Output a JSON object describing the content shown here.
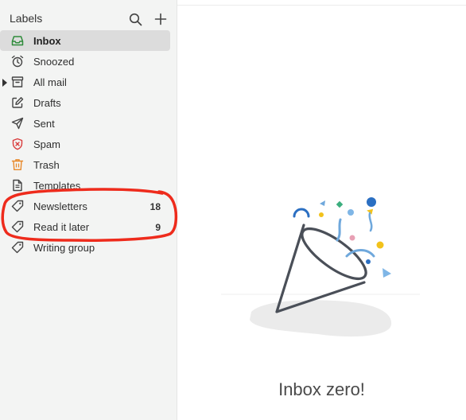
{
  "sidebar": {
    "title": "Labels",
    "items": [
      {
        "label": "Inbox",
        "icon": "inbox-icon",
        "active": true
      },
      {
        "label": "Snoozed",
        "icon": "snooze-clock-icon"
      },
      {
        "label": "All mail",
        "icon": "archive-box-icon"
      },
      {
        "label": "Drafts",
        "icon": "draft-edit-icon"
      },
      {
        "label": "Sent",
        "icon": "paper-plane-icon"
      },
      {
        "label": "Spam",
        "icon": "spam-shield-icon"
      },
      {
        "label": "Trash",
        "icon": "trash-can-icon"
      },
      {
        "label": "Templates",
        "icon": "template-doc-icon"
      },
      {
        "label": "Newsletters",
        "icon": "tag-icon",
        "count": "18"
      },
      {
        "label": "Read it later",
        "icon": "tag-icon",
        "count": "9"
      },
      {
        "label": "Writing group",
        "icon": "tag-icon"
      }
    ]
  },
  "main": {
    "empty_message": "Inbox zero!"
  },
  "colors": {
    "active_bg": "#dcdcdc",
    "inbox_icon": "#2e8b3a",
    "spam_icon": "#d93a3a",
    "trash_icon": "#e8892b",
    "annotation": "#ee2b1c"
  }
}
